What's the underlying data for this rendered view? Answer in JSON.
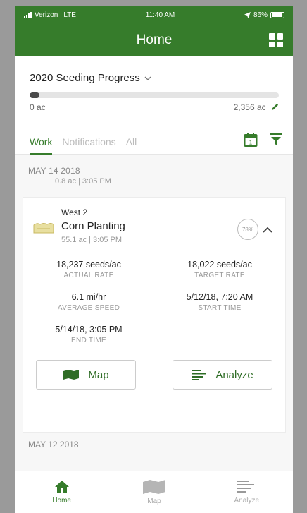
{
  "status_bar": {
    "carrier": "Verizon",
    "network": "LTE",
    "time": "11:40 AM",
    "battery": "86%"
  },
  "header": {
    "title": "Home",
    "menu_icon": "grid-icon"
  },
  "progress": {
    "title": "2020 Seeding Progress",
    "fill_fraction": 0.02,
    "start_label": "0 ac",
    "end_label": "2,356 ac"
  },
  "tabs": [
    {
      "label": "Work",
      "active": true
    },
    {
      "label": "Notifications",
      "active": false
    },
    {
      "label": "All",
      "active": false
    }
  ],
  "feed": {
    "date_1": "MAY 14 2018",
    "date_1_sub": "0.8 ac | 3:05 PM",
    "date_2": "MAY 12 2018"
  },
  "card": {
    "field": "West 2",
    "operation": "Corn Planting",
    "sub": "55.1 ac | 3:05 PM",
    "percent": "78%",
    "stats": [
      {
        "value": "18,237 seeds/ac",
        "label": "ACTUAL RATE"
      },
      {
        "value": "18,022 seeds/ac",
        "label": "TARGET RATE"
      },
      {
        "value": "6.1 mi/hr",
        "label": "AVERAGE SPEED"
      },
      {
        "value": "5/12/18, 7:20 AM",
        "label": "START TIME"
      },
      {
        "value": "5/14/18, 3:05 PM",
        "label": "END TIME"
      }
    ],
    "map_button": "Map",
    "analyze_button": "Analyze"
  },
  "bottom_nav": [
    {
      "label": "Home",
      "icon": "home-icon",
      "active": true
    },
    {
      "label": "Map",
      "icon": "map-icon",
      "active": false
    },
    {
      "label": "Analyze",
      "icon": "analyze-icon",
      "active": false
    }
  ],
  "colors": {
    "brand_green": "#367c2b",
    "progress_fill": "#4a4a4a"
  }
}
